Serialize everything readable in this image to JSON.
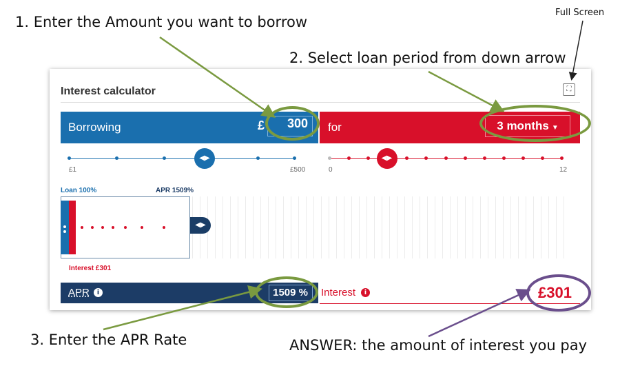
{
  "annotations": {
    "step1": "1. Enter the Amount you want to borrow",
    "step2": "2. Select loan period from down arrow",
    "step3": "3. Enter the APR Rate",
    "answer": "ANSWER: the amount of interest you pay",
    "full_screen": "Full Screen"
  },
  "calculator": {
    "title": "Interest calculator",
    "borrowing_label": "Borrowing",
    "currency_symbol": "£",
    "amount_value": "300",
    "for_label": "for",
    "period_value": "3 months",
    "amount_slider": {
      "min_label": "£1",
      "max_label": "£500",
      "value": 300,
      "min": 1,
      "max": 500
    },
    "period_slider": {
      "min_label": "0",
      "max_label": "12",
      "value": 3,
      "min": 0,
      "max": 12
    },
    "chart": {
      "loan_label": "Loan 100%",
      "apr_label": "APR 1509%",
      "interest_label": "Interest £301"
    },
    "apr_label": "APR",
    "apr_value": "1509 %",
    "interest_label": "Interest",
    "interest_value": "£301"
  },
  "colors": {
    "blue": "#1a6fae",
    "red": "#d8102a",
    "navy": "#1c3c66",
    "annotation_green": "#7a9a40",
    "annotation_purple": "#6a4e8c"
  }
}
